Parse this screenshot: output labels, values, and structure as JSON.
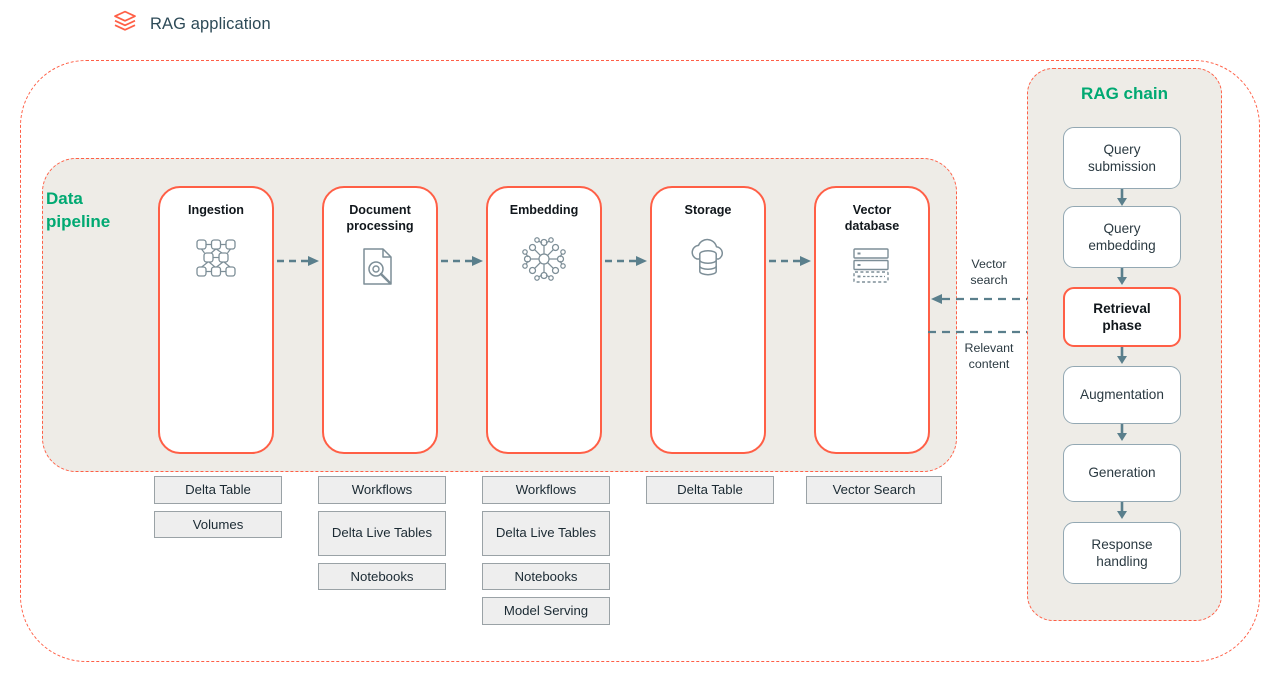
{
  "app": {
    "title": "RAG application",
    "logo_icon": "databricks-stack-logo-icon",
    "accent_red": "#ff5f46",
    "accent_green": "#00a972",
    "panel_bg": "#eeece7",
    "arrow_color": "#5a7f8c"
  },
  "pipeline": {
    "title": "Data\npipeline",
    "title_line1": "Data",
    "title_line2": "pipeline",
    "stages": [
      {
        "title": "Ingestion",
        "title_lines": [
          "Ingestion"
        ],
        "icon": "network-nodes-icon",
        "items": [
          "Delta Table",
          "Volumes"
        ]
      },
      {
        "title": "Document processing",
        "title_lines": [
          "Document",
          "processing"
        ],
        "icon": "document-search-icon",
        "items": [
          "Workflows",
          "Delta Live Tables",
          "Notebooks"
        ]
      },
      {
        "title": "Embedding",
        "title_lines": [
          "Embedding"
        ],
        "icon": "embedding-network-icon",
        "items": [
          "Workflows",
          "Delta Live Tables",
          "Notebooks",
          "Model Serving"
        ]
      },
      {
        "title": "Storage",
        "title_lines": [
          "Storage"
        ],
        "icon": "cloud-database-icon",
        "items": [
          "Delta Table"
        ]
      },
      {
        "title": "Vector database",
        "title_lines": [
          "Vector",
          "database"
        ],
        "icon": "vector-index-server-icon",
        "items": [
          "Vector Search"
        ]
      }
    ]
  },
  "chain": {
    "title": "RAG chain",
    "steps": [
      {
        "label": "Query submission",
        "lines": [
          "Query",
          "submission"
        ],
        "highlight": false
      },
      {
        "label": "Query embedding",
        "lines": [
          "Query",
          "embedding"
        ],
        "highlight": false
      },
      {
        "label": "Retrieval phase",
        "lines": [
          "Retrieval",
          "phase"
        ],
        "highlight": true
      },
      {
        "label": "Augmentation",
        "lines": [
          "Augmentation"
        ],
        "highlight": false
      },
      {
        "label": "Generation",
        "lines": [
          "Generation"
        ],
        "highlight": false
      },
      {
        "label": "Response handling",
        "lines": [
          "Response",
          "handling"
        ],
        "highlight": false
      }
    ]
  },
  "cross_links": [
    {
      "label": "Vector search",
      "lines": [
        "Vector",
        "search"
      ],
      "direction": "left"
    },
    {
      "label": "Relevant content",
      "lines": [
        "Relevant",
        "content"
      ],
      "direction": "right"
    }
  ]
}
